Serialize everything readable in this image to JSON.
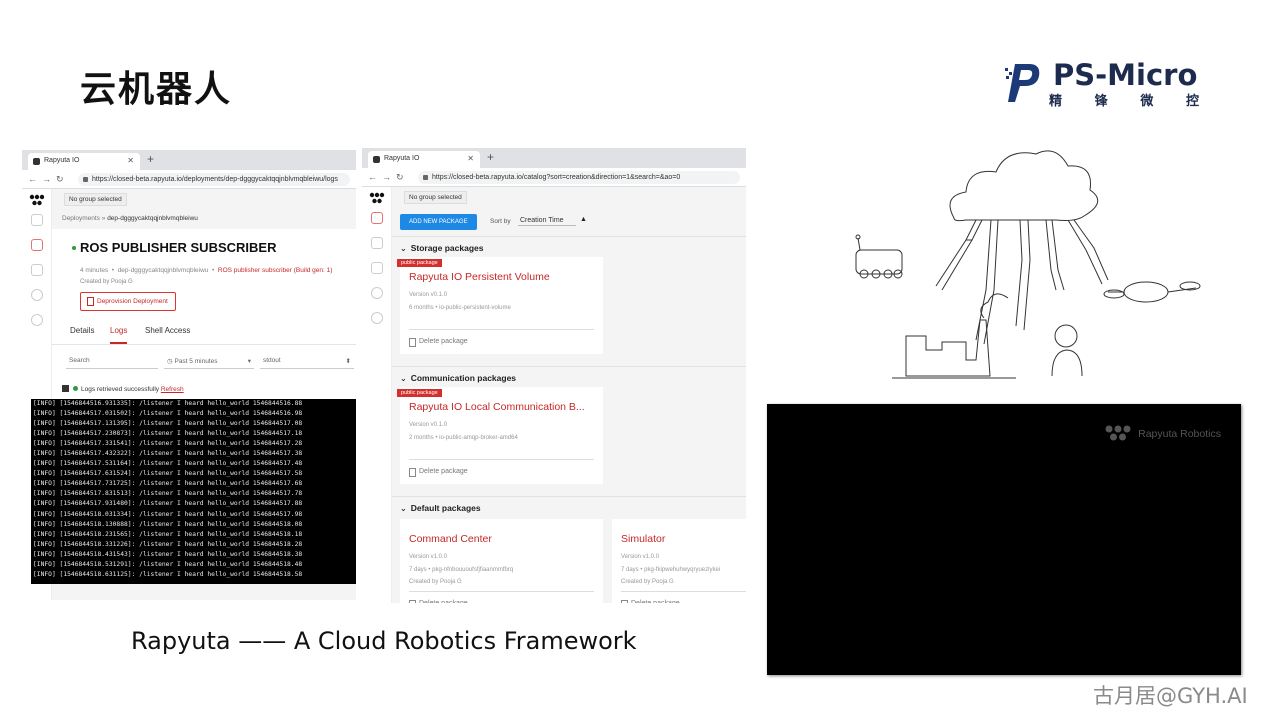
{
  "slide": {
    "title": "云机器人",
    "caption": "Rapyuta —— A Cloud Robotics Framework",
    "watermark": "古月居@GYH.AI",
    "logo": {
      "name": "PS-Micro",
      "sub": [
        "精",
        "锋",
        "微",
        "控"
      ],
      "color": "#1d2b4f"
    }
  },
  "window1": {
    "tab_title": "Rapyuta IO",
    "url": "https://closed-beta.rapyuta.io/deployments/dep-dgggycaktqqjnblvmqbleiwu/logs",
    "group": "No group selected",
    "breadcrumb_root": "Deployments",
    "breadcrumb_sep": "»",
    "breadcrumb_leaf": "dep-dgggycaktqqjnblvmqbleiwu",
    "heading": "ROS PUBLISHER SUBSCRIBER",
    "meta_age": "4 minutes",
    "meta_id": "dep-dgggycaktqqjnblvmqbleiwu",
    "meta_link": "ROS publisher subscriber (Build gen: 1)",
    "created_by": "Created by Pooja G",
    "deprovision_label": "Deprovision Deployment",
    "tabs": [
      "Details",
      "Logs",
      "Shell Access"
    ],
    "active_tab": "Logs",
    "search_placeholder": "Search",
    "time_filter": "Past 5 minutes",
    "stream_filter": "stdout",
    "status_msg": "Logs retrieved successfully",
    "refresh_label": "Refresh",
    "logs": [
      "[INFO] [1546844516.931335]: /listener I heard hello_world 1546844516.88",
      "[INFO] [1546844517.031502]: /listener I heard hello_world 1546844516.98",
      "[INFO] [1546844517.131395]: /listener I heard hello_world 1546844517.08",
      "[INFO] [1546844517.230873]: /listener I heard hello_world 1546844517.18",
      "[INFO] [1546844517.331541]: /listener I heard hello_world 1546844517.28",
      "[INFO] [1546844517.432322]: /listener I heard hello_world 1546844517.38",
      "[INFO] [1546844517.531164]: /listener I heard hello_world 1546844517.48",
      "[INFO] [1546844517.631524]: /listener I heard hello_world 1546844517.58",
      "[INFO] [1546844517.731725]: /listener I heard hello_world 1546844517.68",
      "[INFO] [1546844517.831513]: /listener I heard hello_world 1546844517.78",
      "[INFO] [1546844517.931480]: /listener I heard hello_world 1546844517.88",
      "[INFO] [1546844518.031334]: /listener I heard hello_world 1546844517.98",
      "[INFO] [1546844518.130888]: /listener I heard hello_world 1546844518.08",
      "[INFO] [1546844518.231565]: /listener I heard hello_world 1546844518.18",
      "[INFO] [1546844518.331226]: /listener I heard hello_world 1546844518.28",
      "[INFO] [1546844518.431543]: /listener I heard hello_world 1546844518.38",
      "[INFO] [1546844518.531291]: /listener I heard hello_world 1546844518.48",
      "[INFO] [1546844518.631125]: /listener I heard hello_world 1546844518.58"
    ]
  },
  "window2": {
    "tab_title": "Rapyuta IO",
    "url": "https://closed-beta.rapyuta.io/catalog?sort=creation&direction=1&search=&ao=0",
    "group": "No group selected",
    "add_new": "ADD NEW PACKAGE",
    "sort_label": "Sort by",
    "sort_value": "Creation Time",
    "sections": [
      {
        "title": "Storage packages",
        "cards": [
          {
            "ribbon": "public package",
            "name": "Rapyuta IO Persistent Volume",
            "version": "Version v0.1.0",
            "meta": "6 months  •  io-public-persistent-volume",
            "created_by": "",
            "delete": "Delete package"
          }
        ]
      },
      {
        "title": "Communication packages",
        "cards": [
          {
            "ribbon": "public package",
            "name": "Rapyuta IO Local Communication B...",
            "version": "Version v0.1.0",
            "meta": "2 months  •  io-public-amqp-broker-amd64",
            "created_by": "",
            "delete": "Delete package"
          }
        ]
      },
      {
        "title": "Default packages",
        "cards": [
          {
            "ribbon": "",
            "name": "Command Center",
            "version": "Version v1.0.0",
            "meta": "7 days  •  pkg-nfnbouuoufsfjfiaanmmfbrq",
            "created_by": "Created by Pooja G",
            "delete": "Delete package"
          },
          {
            "ribbon": "",
            "name": "Simulator",
            "version": "Version v1.0.0",
            "meta": "7 days  •  pkg-fkipwehuhwyqryuezlykei",
            "created_by": "Created by Pooja G",
            "delete": "Delete package"
          }
        ]
      }
    ]
  },
  "video": {
    "brand": "Rapyuta Robotics",
    "bg": "#000000"
  },
  "colors": {
    "accent_red": "#c62828",
    "button_blue": "#1e88e5",
    "status_green": "#2e9a3f"
  }
}
